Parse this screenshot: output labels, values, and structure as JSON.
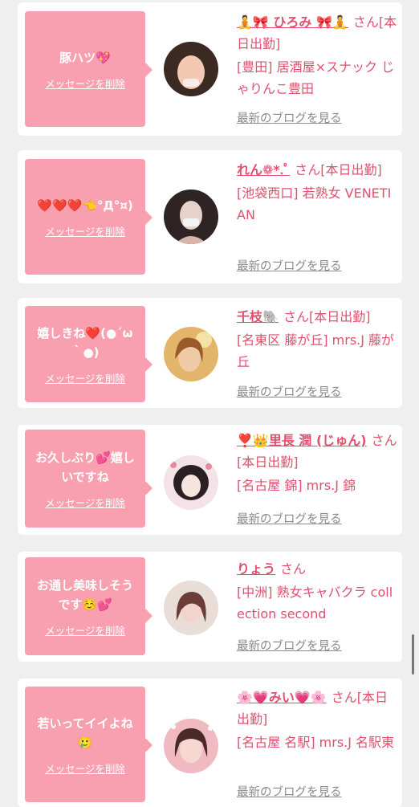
{
  "cards": [
    {
      "message": "豚ハツ💖",
      "delete_label": "メッセージを削除",
      "name": "🧘🎀 ひろみ 🎀🧘",
      "suffix": "さん",
      "status": "[本日出勤]",
      "shop": "[豊田] 居酒屋×スナック じゃりんこ豊田",
      "blog_label": "最新のブログを見る",
      "avatar_colors": [
        "#f3c9b4",
        "#3a2a22"
      ]
    },
    {
      "message": "❤️❤️❤️👈°Д°¤)",
      "delete_label": "メッセージを削除",
      "name": "れん❁*.ﾟ",
      "suffix": "さん",
      "status": "[本日出勤]",
      "shop": "[池袋西口] 若熟女 VENETIAN",
      "blog_label": "最新のブログを見る",
      "avatar_colors": [
        "#3a2b2b",
        "#e6d2c8"
      ]
    },
    {
      "message": "嬉しきね❤️(●´ω｀●)",
      "delete_label": "メッセージを削除",
      "name": "千枝🐘",
      "suffix": "さん",
      "status": "[本日出勤]",
      "shop": "[名東区 藤が丘] mrs.J 藤が丘",
      "blog_label": "最新のブログを見る",
      "avatar_colors": [
        "#d89a4e",
        "#7a4a22"
      ]
    },
    {
      "message": "お久しぶり💕嬉しいですね",
      "delete_label": "メッセージを削除",
      "name": "❣️👑里長 潤 (じゅん)",
      "suffix": "さん",
      "status": "[本日出勤]",
      "shop": "[名古屋 錦] mrs.J 錦",
      "blog_label": "最新のブログを見る",
      "avatar_colors": [
        "#f6e6ea",
        "#2a1f22"
      ]
    },
    {
      "message": "お通し美味しそうです☺️💕",
      "delete_label": "メッセージを削除",
      "name": "りょう",
      "suffix": "さん",
      "status": "",
      "shop": "[中洲] 熟女キャバクラ collection second",
      "blog_label": "最新のブログを見る",
      "avatar_colors": [
        "#e8d6d2",
        "#6b3c38"
      ]
    },
    {
      "message": "若いってイイよね🥲",
      "delete_label": "メッセージを削除",
      "name": "🌸💗みい💗🌸",
      "suffix": "さん",
      "status": "[本日出勤]",
      "shop": "[名古屋 名駅] mrs.J 名駅東",
      "blog_label": "最新のブログを見る",
      "avatar_colors": [
        "#f1b9c2",
        "#4a2a26"
      ]
    }
  ]
}
